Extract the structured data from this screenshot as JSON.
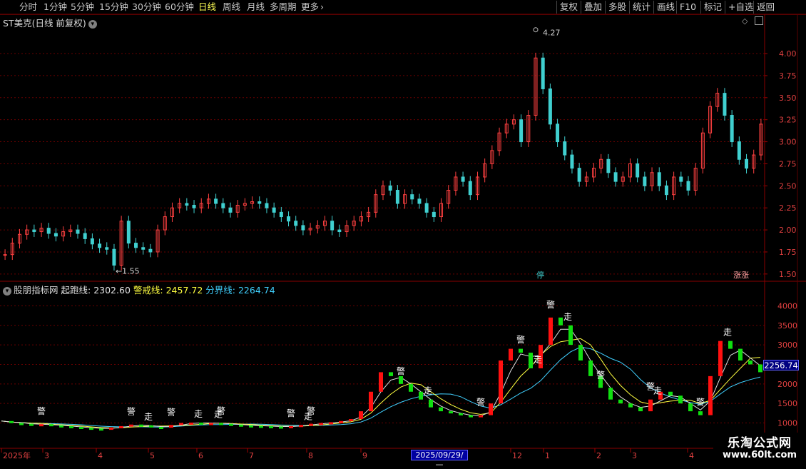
{
  "toolbar": {
    "periods": [
      {
        "label": "分时",
        "active": false
      },
      {
        "label": "1分钟",
        "active": false
      },
      {
        "label": "5分钟",
        "active": false
      },
      {
        "label": "15分钟",
        "active": false
      },
      {
        "label": "30分钟",
        "active": false
      },
      {
        "label": "60分钟",
        "active": false
      },
      {
        "label": "日线",
        "active": true
      },
      {
        "label": "周线",
        "active": false
      },
      {
        "label": "月线",
        "active": false
      },
      {
        "label": "多周期",
        "active": false
      },
      {
        "label": "更多",
        "active": false
      }
    ],
    "more_chevron": "chevron-right-icon",
    "right_buttons": [
      "复权",
      "叠加",
      "多股",
      "统计",
      "画线",
      "F10",
      "标记",
      "+自选",
      "返回"
    ]
  },
  "main_chart": {
    "title": "ST美克(日线 前复权)",
    "y_ticks": [
      "4.00",
      "3.75",
      "3.50",
      "3.25",
      "3.00",
      "2.75",
      "2.50",
      "2.25",
      "2.00",
      "1.75",
      "1.50"
    ],
    "max_label": "4.27",
    "min_label": "1.55",
    "badge_stop": "停",
    "badge_limit": "涨涨"
  },
  "indicator": {
    "name": "股朋指标网",
    "line1_label": "起跑线:",
    "line1_value": "2302.60",
    "line2_label": "警戒线:",
    "line2_value": "2457.72",
    "line3_label": "分界线:",
    "line3_value": "2264.74",
    "y_ticks": [
      "4000",
      "3500",
      "3000",
      "2500",
      "2000",
      "1500",
      "1000"
    ],
    "cursor_value": "2256.74",
    "signal_warn": "警",
    "signal_go": "走"
  },
  "x_axis": {
    "labels": [
      "2025年",
      "3",
      "4",
      "5",
      "6",
      "7",
      "8",
      "9",
      "12",
      "1",
      "2",
      "3",
      "4"
    ],
    "selected_date": "2025/09/29/—"
  },
  "watermark": {
    "line1": "乐淘公式网",
    "line2": "www.60lt.com"
  },
  "chart_data": {
    "type": "candlestick",
    "title": "ST美克(日线 前复权)",
    "ylim": [
      1.45,
      4.3
    ],
    "high_label": 4.27,
    "low_label": 1.55,
    "closes": [
      1.72,
      1.85,
      1.95,
      2.0,
      1.98,
      2.02,
      1.96,
      1.93,
      1.98,
      2.0,
      1.96,
      1.9,
      1.84,
      1.8,
      1.78,
      1.6,
      2.1,
      1.85,
      1.8,
      1.78,
      1.75,
      2.0,
      2.15,
      2.25,
      2.3,
      2.28,
      2.25,
      2.3,
      2.35,
      2.3,
      2.25,
      2.2,
      2.28,
      2.3,
      2.32,
      2.3,
      2.25,
      2.2,
      2.15,
      2.1,
      2.05,
      2.0,
      2.02,
      2.05,
      2.1,
      2.0,
      1.98,
      2.05,
      2.1,
      2.15,
      2.2,
      2.4,
      2.5,
      2.45,
      2.3,
      2.4,
      2.35,
      2.3,
      2.2,
      2.15,
      2.3,
      2.45,
      2.6,
      2.55,
      2.4,
      2.6,
      2.75,
      2.9,
      3.1,
      3.2,
      3.25,
      3.0,
      3.3,
      3.95,
      3.6,
      3.2,
      3.0,
      2.85,
      2.7,
      2.55,
      2.6,
      2.7,
      2.8,
      2.65,
      2.55,
      2.6,
      2.75,
      2.6,
      2.5,
      2.65,
      2.5,
      2.4,
      2.6,
      2.55,
      2.45,
      2.7,
      3.1,
      3.4,
      3.55,
      3.3,
      3.0,
      2.8,
      2.7,
      2.85,
      3.2
    ],
    "indicator": {
      "name": "股朋指标网",
      "ylim": [
        900,
        4300
      ],
      "series": [
        {
          "name": "起跑线",
          "value": 2302.6
        },
        {
          "name": "警戒线",
          "value": 2457.72
        },
        {
          "name": "分界线",
          "value": 2264.74
        }
      ],
      "curve": [
        1050,
        1000,
        980,
        960,
        970,
        940,
        920,
        900,
        880,
        860,
        850,
        880,
        920,
        960,
        940,
        900,
        880,
        950,
        1000,
        1010,
        990,
        1000,
        980,
        960,
        940,
        930,
        920,
        910,
        900,
        920,
        950,
        980,
        1000,
        1020,
        1050,
        1100,
        1300,
        1800,
        2300,
        2200,
        2000,
        1800,
        1600,
        1400,
        1300,
        1250,
        1200,
        1150,
        1200,
        1500,
        2600,
        2900,
        2800,
        2400,
        3000,
        3700,
        3500,
        3000,
        2600,
        2200,
        1900,
        1600,
        1500,
        1400,
        1300,
        1600,
        1800,
        1700,
        1500,
        1300,
        1200,
        2200,
        3100,
        2900,
        2600,
        2500,
        2300
      ],
      "warn_positions": [
        0.05,
        0.17,
        0.22,
        0.29,
        0.38,
        0.41,
        0.53,
        0.63,
        0.68,
        0.73,
        0.79,
        0.86,
        0.92
      ],
      "go_positions": [
        0.19,
        0.25,
        0.28,
        0.4,
        0.55,
        0.7,
        0.74,
        0.85,
        0.95
      ]
    }
  }
}
